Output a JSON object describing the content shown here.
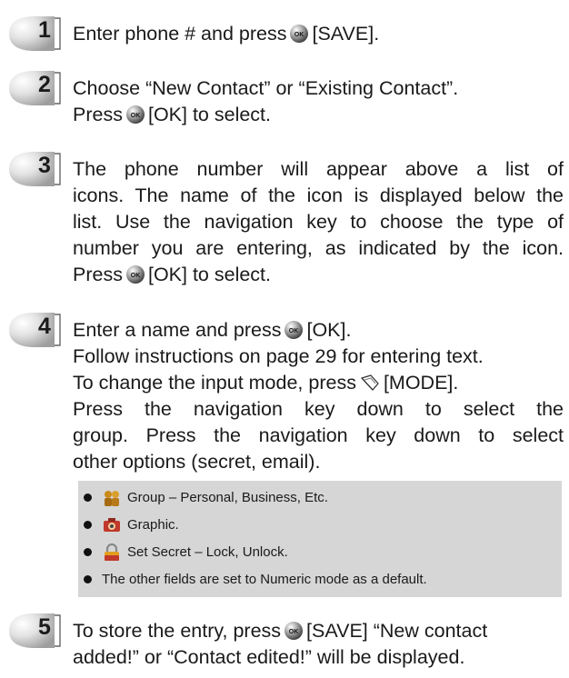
{
  "steps": [
    {
      "number": "1",
      "lines": [
        {
          "before": "Enter phone # and press",
          "after": "[SAVE]."
        }
      ]
    },
    {
      "number": "2",
      "lines": [
        {
          "text": "Choose “New Contact” or “Existing Contact”."
        },
        {
          "before": "Press",
          "after": "[OK] to select."
        }
      ]
    },
    {
      "number": "3",
      "lines": [
        {
          "text": "The phone number will appear above a list of"
        },
        {
          "text": "icons. The name of the icon is displayed below the"
        },
        {
          "text": "list. Use the navigation key to choose the type of"
        },
        {
          "text": "number you are entering, as indicated by the icon."
        },
        {
          "before": "Press",
          "after": "[OK] to select."
        }
      ]
    },
    {
      "number": "4",
      "lines": [
        {
          "before": "Enter a name and press",
          "after": "[OK]."
        },
        {
          "text": "Follow instructions on page 29 for entering text."
        },
        {
          "before": "To change the input mode, press",
          "after": "[MODE]."
        },
        {
          "text": "Press the navigation key down to select the"
        },
        {
          "text": "group. Press the navigation key down to select"
        },
        {
          "text": "other options (secret, email)."
        }
      ]
    },
    {
      "number": "5",
      "lines": [
        {
          "before": "To store the entry, press",
          "after": "[SAVE] “New contact"
        },
        {
          "text": "added!” or “Contact edited!” will be displayed."
        }
      ]
    }
  ],
  "options": [
    {
      "icon": "group-icon",
      "label": "Group – Personal, Business, Etc."
    },
    {
      "icon": "graphic-icon",
      "label": "Graphic."
    },
    {
      "icon": "lock-icon",
      "label": "Set Secret – Lock, Unlock."
    },
    {
      "icon": "",
      "label": "The other fields are set to Numeric mode as a default."
    }
  ],
  "icons": {
    "step_badge": "step-number-badge-icon",
    "ok_button": "ok-button-icon",
    "soft_key": "soft-key-icon"
  },
  "colors": {
    "text": "#1a1a1a",
    "options_background": "#d6d6d6",
    "badge_gray": "#c9c9c9"
  }
}
